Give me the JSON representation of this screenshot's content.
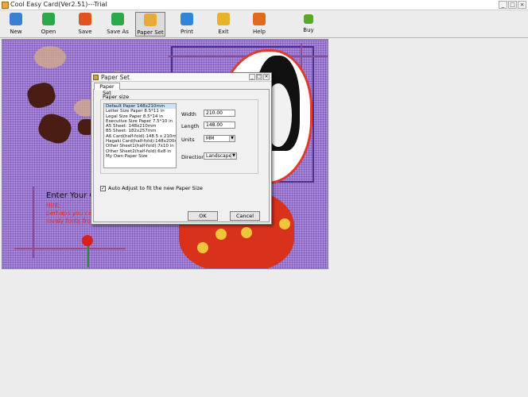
{
  "window": {
    "title": "Cool Easy Card(Ver2.51)---Trial",
    "controls": [
      "_",
      "□",
      "×"
    ]
  },
  "toolbar": {
    "buttons": [
      {
        "label": "New",
        "icon": "new-icon",
        "color": "#3a7fd0"
      },
      {
        "label": "Open",
        "icon": "open-icon",
        "color": "#2aa84a"
      },
      {
        "label": "Save",
        "icon": "save-icon",
        "color": "#e0531e"
      },
      {
        "label": "Save As",
        "icon": "save-as-icon",
        "color": "#2aa84a"
      },
      {
        "label": "Paper Set",
        "icon": "paper-set-icon",
        "color": "#e6a93a",
        "active": true
      },
      {
        "label": "Print",
        "icon": "print-icon",
        "color": "#2f86d8"
      },
      {
        "label": "Exit",
        "icon": "exit-icon",
        "color": "#e6b22a"
      },
      {
        "label": "Help",
        "icon": "help-icon",
        "color": "#e06a1e"
      },
      {
        "label": "Buy",
        "icon": "buy-icon",
        "color": "#5aa82a"
      }
    ]
  },
  "card": {
    "heading": "Enter Your O",
    "hint_lines": [
      "Hint:",
      "perhaps you ca",
      "lovely fonts fro"
    ]
  },
  "dialog": {
    "title": "Paper Set",
    "tab": "Paper Set",
    "group_label": "Paper size",
    "paper_sizes": [
      "Default Paper 148x210mm",
      "Letter Size Paper 8.5*11 in",
      "Legal Size Paper  8.5*14 in",
      "Executive Size Paper 7.5*10 in",
      "A5 Sheet: 148x210mm",
      "B5 Sheet: 182x257mm",
      "A6 Card(half-fold):148.5 x 210mm",
      "Hagaki Card(half-fold):148x200mm",
      "Other Sheet1(half-fold):7x10 in",
      "Other Sheet2(half-fold):6x8 in",
      "My Own Paper Size"
    ],
    "selected_index": 0,
    "width_label": "Width",
    "width_value": "210.00",
    "length_label": "Length",
    "length_value": "148.00",
    "units_label": "Units",
    "units_value": "MM",
    "direction_label": "Direction",
    "direction_value": "Landscape",
    "auto_adjust_label": "Auto Adjust to fit the new Paper Size",
    "auto_adjust_checked": true,
    "ok_label": "OK",
    "cancel_label": "Cancel"
  }
}
